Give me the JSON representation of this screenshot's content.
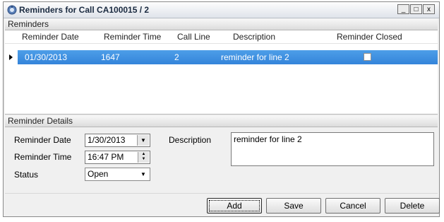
{
  "window": {
    "title": "Reminders for Call CA100015 / 2",
    "controls": [
      "_",
      "□",
      "x"
    ]
  },
  "reminders": {
    "section_label": "Reminders",
    "columns": [
      "Reminder Date",
      "Reminder Time",
      "Call Line",
      "Description",
      "Reminder Closed"
    ],
    "rows": [
      {
        "date": "01/30/2013",
        "time": "1647",
        "call_line": "2",
        "description": "reminder for line 2",
        "closed": false
      }
    ]
  },
  "details": {
    "section_label": "Reminder Details",
    "date_label": "Reminder Date",
    "date_value": "1/30/2013",
    "time_label": "Reminder Time",
    "time_value": "16:47 PM",
    "status_label": "Status",
    "status_value": "Open",
    "description_label": "Description",
    "description_value": "reminder for line 2"
  },
  "buttons": {
    "add": "Add",
    "save": "Save",
    "cancel": "Cancel",
    "delete": "Delete"
  }
}
